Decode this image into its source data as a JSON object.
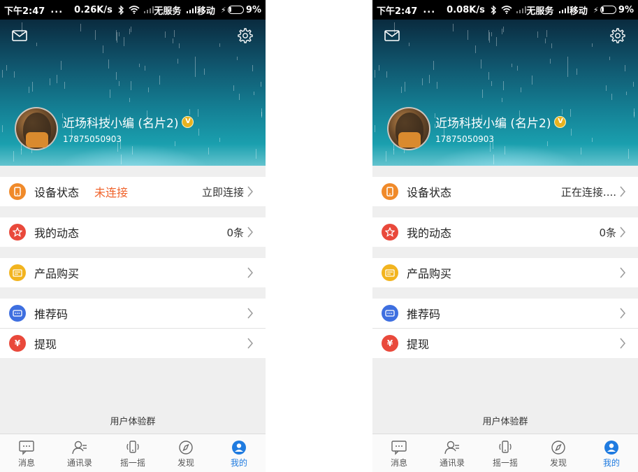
{
  "screens": [
    {
      "status_bar": {
        "time": "下午2:47",
        "dots": "...",
        "speed": "0.26K/s",
        "carrier1": "无服务",
        "carrier2": "移动",
        "battery": "9%"
      },
      "profile": {
        "name": "近场科技小编 (名片2)",
        "phone": "17875050903"
      },
      "menu": [
        {
          "label": "设备状态",
          "status": "未连接",
          "value": "立即连接"
        },
        {
          "label": "我的动态",
          "value": "0条"
        },
        {
          "label": "产品购买"
        },
        {
          "label": "推荐码"
        },
        {
          "label": "提现"
        }
      ],
      "footer": "用户体验群",
      "tabs": [
        {
          "label": "消息"
        },
        {
          "label": "通讯录"
        },
        {
          "label": "摇一摇"
        },
        {
          "label": "发现"
        },
        {
          "label": "我的"
        }
      ]
    },
    {
      "status_bar": {
        "time": "下午2:47",
        "dots": "...",
        "speed": "0.08K/s",
        "carrier1": "无服务",
        "carrier2": "移动",
        "battery": "9%"
      },
      "profile": {
        "name": "近场科技小编 (名片2)",
        "phone": "17875050903"
      },
      "menu": [
        {
          "label": "设备状态",
          "value": "正在连接...."
        },
        {
          "label": "我的动态",
          "value": "0条"
        },
        {
          "label": "产品购买"
        },
        {
          "label": "推荐码"
        },
        {
          "label": "提现"
        }
      ],
      "footer": "用户体验群",
      "tabs": [
        {
          "label": "消息"
        },
        {
          "label": "通讯录"
        },
        {
          "label": "摇一摇"
        },
        {
          "label": "发现"
        },
        {
          "label": "我的"
        }
      ]
    }
  ],
  "icons": {
    "device": "phone-icon",
    "moments": "star-icon",
    "purchase": "card-icon",
    "referral": "code-icon",
    "withdraw": "yuan-icon"
  },
  "colors": {
    "accent": "#1f7be0",
    "warning": "#f0622a",
    "orange": "#f08a2a",
    "red": "#e9493b",
    "yellow": "#f2b41f",
    "blue": "#3e6fe0"
  },
  "vip_badge": "V",
  "withdraw_glyph": "¥",
  "active_tab_index": 4
}
